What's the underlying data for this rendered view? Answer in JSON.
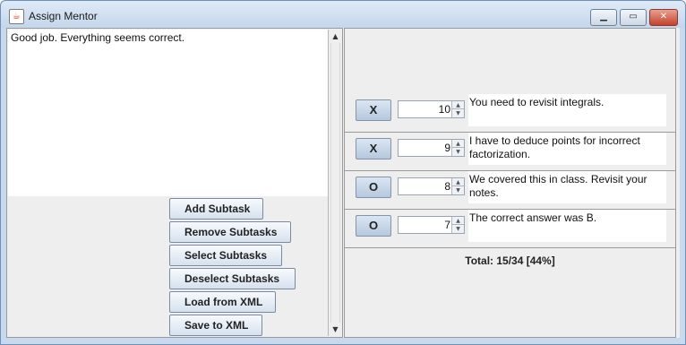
{
  "window": {
    "title": "Assign Mentor",
    "app_icon": "java-cup-icon",
    "controls": {
      "minimize": "minimize-icon",
      "maximize": "maximize-icon",
      "close": "close-icon"
    }
  },
  "editor": {
    "text": "Good job. Everything seems correct."
  },
  "actions": {
    "add_subtask": "Add Subtask",
    "remove_subtasks": "Remove Subtasks",
    "select_subtasks": "Select Subtasks",
    "deselect_subtasks": "Deselect Subtasks",
    "load_xml": "Load from XML",
    "save_xml": "Save to XML"
  },
  "subtasks": [
    {
      "mark": "X",
      "points": "10",
      "comment": "You need to revisit integrals."
    },
    {
      "mark": "X",
      "points": "9",
      "comment": "I have to deduce points for incorrect factorization."
    },
    {
      "mark": "O",
      "points": "8",
      "comment": "We covered this in class. Revisit your notes."
    },
    {
      "mark": "O",
      "points": "7",
      "comment": "The correct answer was B."
    }
  ],
  "summary": {
    "total": "Total: 15/34   [44%]"
  }
}
